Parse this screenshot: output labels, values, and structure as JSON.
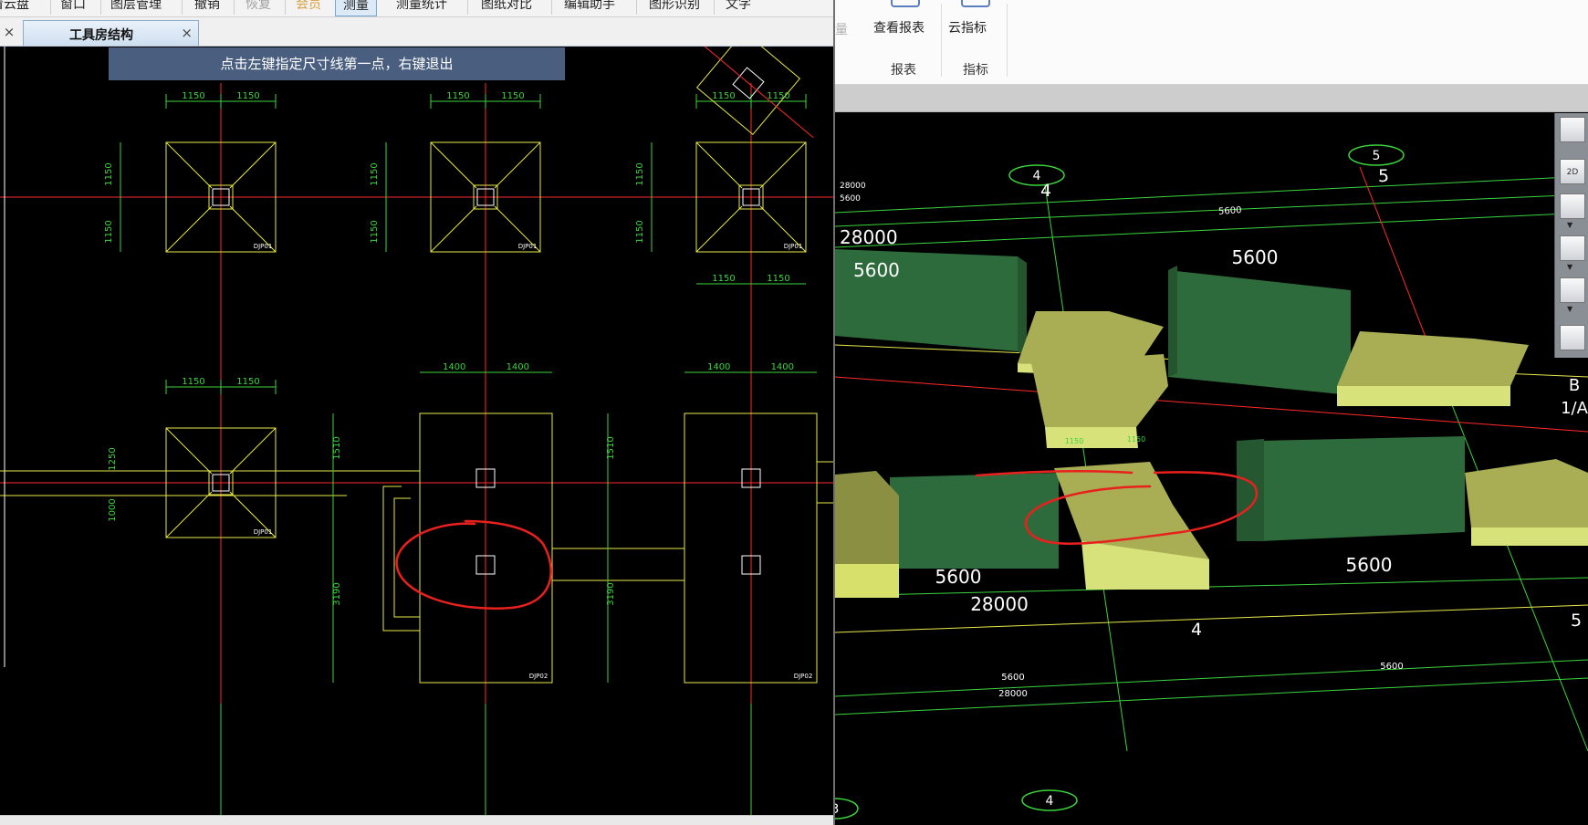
{
  "menu": {
    "items": [
      {
        "label": "看云盘",
        "state": "normal"
      },
      {
        "label": "窗口",
        "state": "normal"
      },
      {
        "label": "图层管理",
        "state": "normal"
      },
      {
        "label": "撤销",
        "state": "normal"
      },
      {
        "label": "恢复",
        "state": "disabled"
      },
      {
        "label": "会员",
        "state": "vip"
      },
      {
        "label": "测量",
        "state": "active"
      },
      {
        "label": "测量统计",
        "state": "normal"
      },
      {
        "label": "图纸对比",
        "state": "normal"
      },
      {
        "label": "编辑助手",
        "state": "normal"
      },
      {
        "label": "图形识别",
        "state": "normal"
      },
      {
        "label": "文字",
        "state": "normal"
      }
    ]
  },
  "tabs": {
    "active_label": "工具房结构",
    "close_glyph": "×"
  },
  "hint": {
    "text": "点击左键指定尺寸线第一点，右键退出"
  },
  "cad2d": {
    "dims": {
      "d1150": "1150",
      "d1400": "1400",
      "d1510": "1510",
      "d3190": "3190",
      "d1250": "1250",
      "d1000": "1000"
    },
    "labels": {
      "footing": "DJP01",
      "footing_b": "DJP02"
    }
  },
  "ribbon": {
    "cut_label": "量",
    "buttons": [
      {
        "label": "查看报表",
        "icon": "report-icon"
      },
      {
        "label": "云指标",
        "icon": "cloud-index-icon"
      }
    ],
    "groups": [
      {
        "label": "报表"
      },
      {
        "label": "指标"
      }
    ]
  },
  "scene3d": {
    "axis_labels": {
      "a4": "4",
      "a5": "5",
      "a3": "3",
      "aB": "B",
      "a1A": "1/A"
    },
    "dims": {
      "d28000": "28000",
      "d5600": "5600",
      "d1150": "1150"
    }
  },
  "toolbar3d": {
    "view2d_label": "2D"
  },
  "colors": {
    "cad_bg": "#000000",
    "axis_red": "#ff2a2a",
    "dim_green": "#3cd43c",
    "footing_yellow": "#e8e84a",
    "wall_green": "#2e6b3c",
    "footing_olive": "#a9ad54",
    "annotation_red": "#e8201e",
    "hint_bg": "#4a5f80"
  }
}
